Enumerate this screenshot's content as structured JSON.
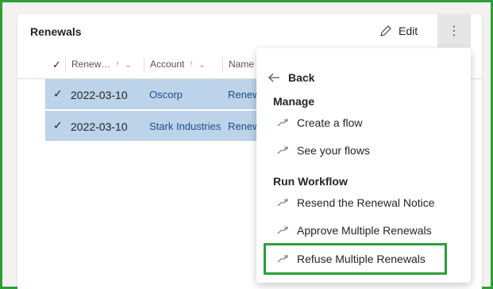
{
  "card": {
    "title": "Renewals"
  },
  "toolbar": {
    "edit_label": "Edit",
    "more_label": "⋮"
  },
  "grid": {
    "columns": [
      {
        "label": "Renew…",
        "sort": "↑",
        "filter": "⌄"
      },
      {
        "label": "Account",
        "sort": "↑",
        "filter": "⌄"
      },
      {
        "label": "Name"
      }
    ],
    "rows": [
      {
        "date": "2022-03-10",
        "account": "Oscorp",
        "name": "Renew"
      },
      {
        "date": "2022-03-10",
        "account": "Stark Industries",
        "name": "Renew"
      }
    ]
  },
  "menu": {
    "back_label": "Back",
    "manage_label": "Manage",
    "manage_items": [
      "Create a flow",
      "See your flows"
    ],
    "workflow_label": "Run Workflow",
    "workflow_items": [
      "Resend the Renewal Notice",
      "Approve Multiple Renewals",
      "Refuse Multiple Renewals"
    ]
  },
  "colors": {
    "accent_green": "#2e9e37",
    "selected_row": "#bcd3ea",
    "link": "#1a4f8b"
  }
}
